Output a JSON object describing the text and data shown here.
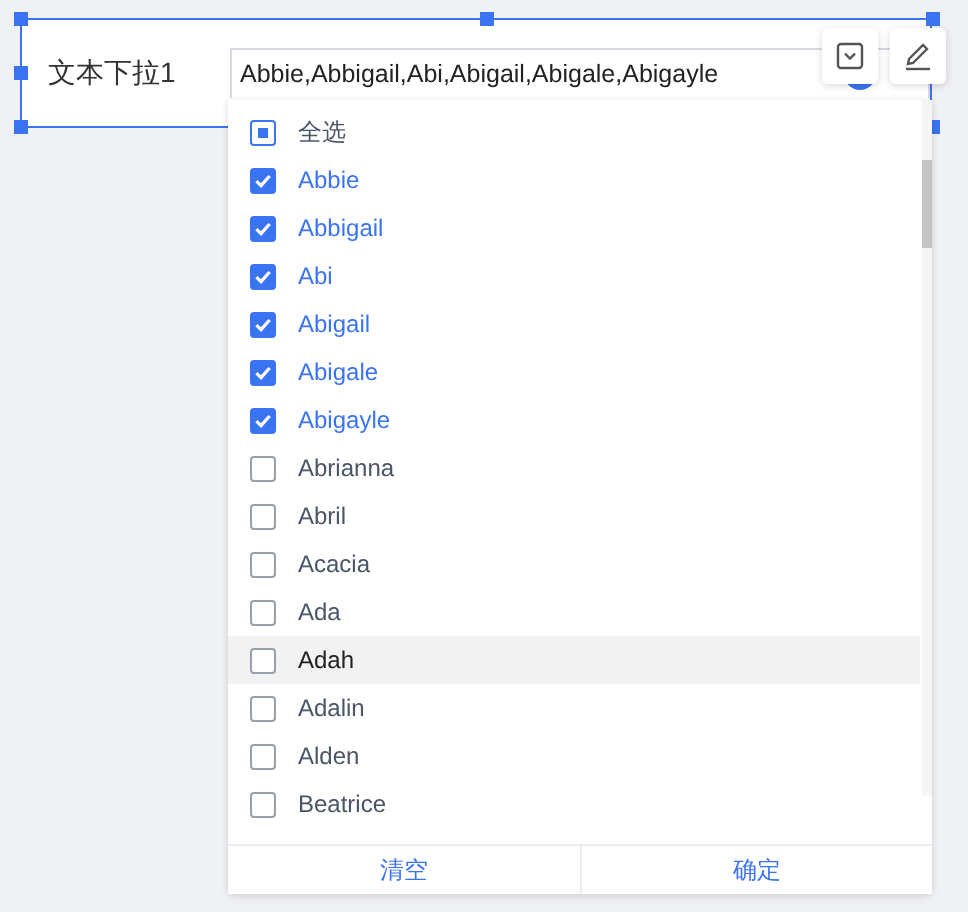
{
  "widget": {
    "label": "文本下拉1",
    "value": "Abbie,Abbigail,Abi,Abigail,Abigale,Abigayle"
  },
  "dropdown": {
    "select_all": {
      "label": "全选",
      "indeterminate": true
    },
    "options": [
      {
        "label": "Abbie",
        "checked": true,
        "highlighted": false
      },
      {
        "label": "Abbigail",
        "checked": true,
        "highlighted": false
      },
      {
        "label": "Abi",
        "checked": true,
        "highlighted": false
      },
      {
        "label": "Abigail",
        "checked": true,
        "highlighted": false
      },
      {
        "label": "Abigale",
        "checked": true,
        "highlighted": false
      },
      {
        "label": "Abigayle",
        "checked": true,
        "highlighted": false
      },
      {
        "label": "Abrianna",
        "checked": false,
        "highlighted": false
      },
      {
        "label": "Abril",
        "checked": false,
        "highlighted": false
      },
      {
        "label": "Acacia",
        "checked": false,
        "highlighted": false
      },
      {
        "label": "Ada",
        "checked": false,
        "highlighted": false
      },
      {
        "label": "Adah",
        "checked": false,
        "highlighted": true
      },
      {
        "label": "Adalin",
        "checked": false,
        "highlighted": false
      },
      {
        "label": "Alden",
        "checked": false,
        "highlighted": false
      },
      {
        "label": "Beatrice",
        "checked": false,
        "highlighted": false
      }
    ],
    "buttons": [
      "清空",
      "确定"
    ]
  }
}
